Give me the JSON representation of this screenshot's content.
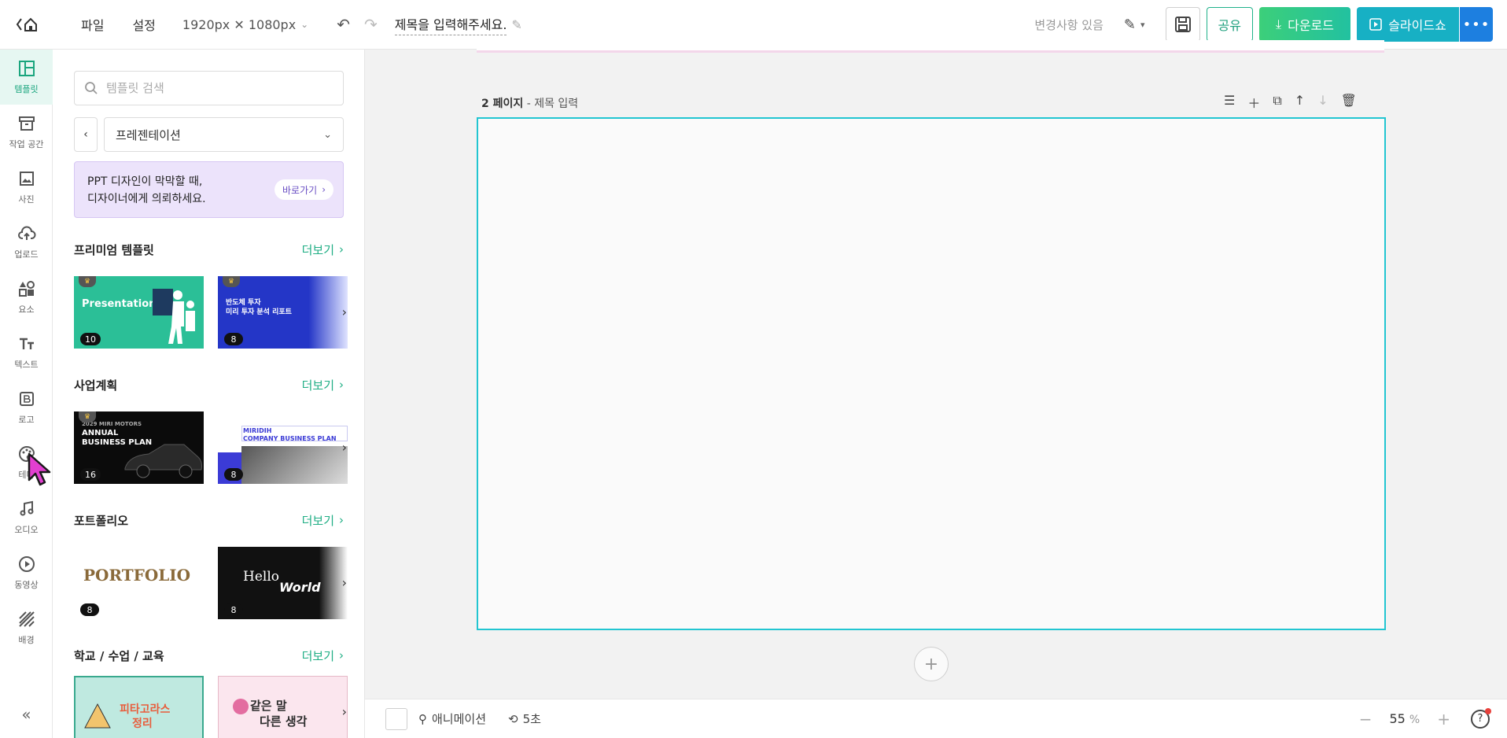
{
  "topbar": {
    "menu": [
      "파일",
      "설정"
    ],
    "size": "1920px ✕ 1080px",
    "title": "제목을 입력해주세요.",
    "status": "변경사항 있음",
    "share": "공유",
    "download": "다운로드",
    "slideshow": "슬라이드쇼"
  },
  "rail": [
    {
      "label": "템플릿",
      "icon": "template-icon",
      "active": true
    },
    {
      "label": "작업 공간",
      "icon": "workspace-icon"
    },
    {
      "label": "사진",
      "icon": "photo-icon"
    },
    {
      "label": "업로드",
      "icon": "upload-icon"
    },
    {
      "label": "요소",
      "icon": "elements-icon"
    },
    {
      "label": "텍스트",
      "icon": "text-icon"
    },
    {
      "label": "로고",
      "icon": "logo-icon"
    },
    {
      "label": "테마",
      "icon": "theme-icon"
    },
    {
      "label": "오디오",
      "icon": "audio-icon"
    },
    {
      "label": "동영상",
      "icon": "video-icon"
    },
    {
      "label": "배경",
      "icon": "background-icon"
    }
  ],
  "panel": {
    "search_placeholder": "템플릿 검색",
    "category": "프레젠테이션",
    "promo": {
      "line1": "PPT 디자인이 막막할 때,",
      "line2": "디자이너에게 의뢰하세요.",
      "button": "바로가기"
    },
    "more": "더보기",
    "sections": [
      {
        "title": "프리미엄 템플릿",
        "counts": [
          "10",
          "8"
        ],
        "t1_text": "Presentation",
        "t2_text1": "반도체 투자",
        "t2_text2": "미리 투자 분석 리포트"
      },
      {
        "title": "사업계획",
        "counts": [
          "16",
          "8"
        ],
        "t1_text1": "2029 MIRI MOTORS",
        "t1_text2": "ANNUAL",
        "t1_text3": "BUSINESS PLAN",
        "t2_text1": "MIRIDIH",
        "t2_text2": "COMPANY BUSINESS PLAN"
      },
      {
        "title": "포트폴리오",
        "counts": [
          "8",
          "8"
        ],
        "t1_text": "PORTFOLIO",
        "t2_text1": "Hello",
        "t2_text2": "World"
      },
      {
        "title": "학교 / 수업 / 교육",
        "t1_text1": "피타고라스",
        "t1_text2": "정리",
        "t2_text1": "같은 말",
        "t2_text2": "다른 생각"
      }
    ]
  },
  "canvas": {
    "page_number": "2 페이지",
    "page_title": "제목 입력"
  },
  "bottombar": {
    "animation": "애니메이션",
    "duration": "5초",
    "zoom": "55",
    "zoom_unit": "%"
  },
  "colors": {
    "accent": "#1fae84",
    "page_border": "#22c5d1",
    "download_start": "#3ccf7a",
    "slideshow": "#17b0c4",
    "more": "#1d7fe0"
  }
}
